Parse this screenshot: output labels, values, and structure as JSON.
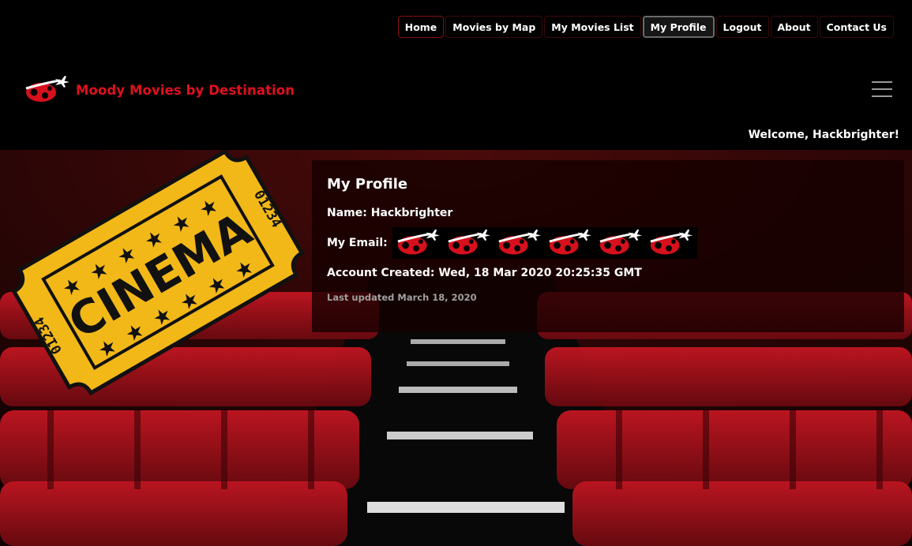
{
  "nav": {
    "items": [
      {
        "label": "Home"
      },
      {
        "label": "Movies by Map"
      },
      {
        "label": "My Movies List"
      },
      {
        "label": "My Profile"
      },
      {
        "label": "Logout"
      },
      {
        "label": "About"
      },
      {
        "label": "Contact Us"
      }
    ],
    "active": "My Profile"
  },
  "brand": {
    "title": "Moody Movies by Destination",
    "logo_icon": "ladybug-plane-icon"
  },
  "welcome": "Welcome, Hackbrighter!",
  "ticket": {
    "word": "CINEMA",
    "serial_top": "01234",
    "serial_bottom": "01234",
    "colors": {
      "ticket": "#f2b818",
      "ink": "#111111"
    }
  },
  "profile": {
    "heading": "My Profile",
    "name_label": "Name:",
    "name_value": "Hackbrighter",
    "email_label": "My Email:",
    "email_icons": [
      "ladybug-plane-icon",
      "ladybug-plane-icon",
      "ladybug-plane-icon",
      "ladybug-plane-icon",
      "ladybug-plane-icon",
      "ladybug-plane-icon"
    ],
    "created_label": "Account Created:",
    "created_value": "Wed, 18 Mar 2020 20:25:35 GMT",
    "last_updated": "Last updated March 18, 2020"
  },
  "colors": {
    "brand_red": "#e0101e",
    "background": "#000000",
    "card": "rgba(20,0,0,0.78)"
  }
}
